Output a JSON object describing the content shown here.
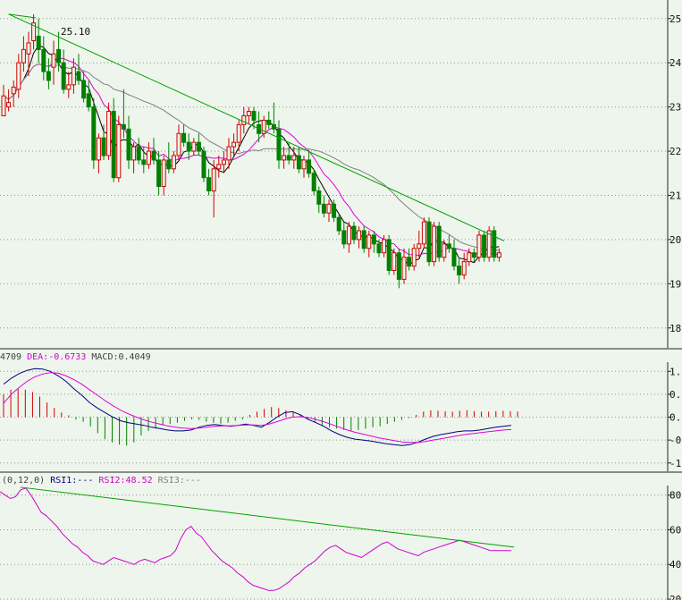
{
  "chart_data": [
    {
      "type": "candlestick",
      "panel": "price",
      "peak_label": "25.10",
      "y_tick_labels": [
        "25.",
        "24.",
        "23.",
        "22.",
        "21.",
        "20.",
        "19.",
        "18."
      ],
      "y_ticks": [
        25,
        24,
        23,
        22,
        21,
        20,
        19,
        18
      ],
      "ylim": [
        17.55,
        25.42
      ],
      "grid": true,
      "up_color": "#d00000",
      "down_color": "#008000",
      "ma_colors": [
        "#000000",
        "#e000e0",
        "#808080"
      ],
      "trendline_color": "#00a000",
      "trendline": [
        [
          1,
          25.1
        ],
        [
          100,
          19.97
        ]
      ],
      "candles": [
        [
          22.8,
          23.5,
          23.0,
          23.25
        ],
        [
          23.0,
          23.4,
          22.9,
          23.1
        ],
        [
          23.3,
          23.6,
          23.0,
          23.45
        ],
        [
          23.4,
          24.2,
          23.2,
          24.0
        ],
        [
          24.0,
          24.6,
          23.8,
          24.3
        ],
        [
          24.2,
          24.7,
          23.7,
          24.45
        ],
        [
          24.5,
          25.1,
          24.3,
          24.9
        ],
        [
          24.6,
          25.0,
          24.0,
          24.3
        ],
        [
          24.3,
          24.6,
          23.6,
          23.8
        ],
        [
          23.8,
          24.1,
          23.4,
          23.6
        ],
        [
          23.9,
          24.5,
          23.5,
          24.2
        ],
        [
          24.3,
          24.7,
          23.8,
          24.0
        ],
        [
          24.0,
          24.3,
          23.3,
          23.4
        ],
        [
          23.4,
          23.8,
          23.2,
          23.5
        ],
        [
          23.5,
          24.1,
          23.3,
          23.9
        ],
        [
          23.8,
          24.2,
          23.5,
          23.6
        ],
        [
          23.6,
          23.8,
          23.1,
          23.2
        ],
        [
          23.3,
          23.6,
          22.9,
          23.0
        ],
        [
          23.0,
          23.2,
          21.6,
          21.8
        ],
        [
          21.8,
          22.4,
          21.5,
          22.3
        ],
        [
          22.3,
          22.6,
          21.8,
          21.9
        ],
        [
          21.9,
          23.1,
          21.8,
          22.9
        ],
        [
          22.9,
          23.2,
          21.3,
          21.4
        ],
        [
          21.4,
          22.8,
          21.3,
          22.6
        ],
        [
          22.6,
          23.4,
          22.3,
          22.5
        ],
        [
          22.5,
          22.8,
          21.6,
          21.8
        ],
        [
          21.8,
          22.2,
          21.5,
          22.1
        ],
        [
          22.1,
          22.3,
          21.7,
          21.8
        ],
        [
          21.8,
          22.1,
          21.5,
          21.7
        ],
        [
          21.7,
          22.2,
          21.6,
          22.0
        ],
        [
          22.0,
          22.3,
          21.7,
          21.8
        ],
        [
          21.8,
          22.0,
          21.0,
          21.2
        ],
        [
          21.2,
          21.9,
          21.0,
          21.8
        ],
        [
          21.8,
          22.2,
          21.5,
          21.6
        ],
        [
          21.6,
          22.0,
          21.5,
          21.9
        ],
        [
          21.9,
          22.6,
          21.8,
          22.4
        ],
        [
          22.4,
          22.6,
          22.1,
          22.2
        ],
        [
          22.2,
          22.4,
          21.8,
          22.0
        ],
        [
          22.0,
          22.3,
          21.9,
          22.2
        ],
        [
          22.2,
          22.4,
          21.9,
          22.0
        ],
        [
          22.0,
          22.1,
          21.3,
          21.4
        ],
        [
          21.4,
          21.6,
          21.0,
          21.1
        ],
        [
          21.1,
          21.8,
          20.5,
          21.6
        ],
        [
          21.6,
          21.9,
          21.4,
          21.7
        ],
        [
          21.7,
          22.0,
          21.5,
          21.8
        ],
        [
          21.8,
          22.3,
          21.6,
          22.1
        ],
        [
          22.1,
          22.4,
          21.9,
          22.2
        ],
        [
          22.2,
          22.7,
          22.0,
          22.6
        ],
        [
          22.6,
          23.0,
          22.4,
          22.8
        ],
        [
          22.8,
          23.0,
          22.6,
          22.9
        ],
        [
          22.9,
          23.0,
          22.5,
          22.7
        ],
        [
          22.6,
          22.9,
          22.2,
          22.4
        ],
        [
          22.4,
          22.8,
          22.3,
          22.7
        ],
        [
          22.7,
          22.9,
          22.5,
          22.6
        ],
        [
          22.6,
          23.1,
          22.4,
          22.5
        ],
        [
          22.5,
          22.7,
          21.6,
          21.8
        ],
        [
          21.8,
          22.1,
          21.6,
          21.9
        ],
        [
          21.9,
          22.2,
          21.7,
          21.8
        ],
        [
          21.8,
          22.1,
          21.6,
          21.9
        ],
        [
          21.9,
          22.1,
          21.5,
          21.6
        ],
        [
          21.6,
          21.9,
          21.4,
          21.8
        ],
        [
          21.8,
          22.0,
          21.4,
          21.5
        ],
        [
          21.5,
          21.6,
          21.0,
          21.1
        ],
        [
          21.1,
          21.2,
          20.6,
          20.8
        ],
        [
          20.8,
          21.0,
          20.5,
          20.6
        ],
        [
          20.6,
          20.9,
          20.4,
          20.8
        ],
        [
          20.8,
          20.9,
          20.4,
          20.5
        ],
        [
          20.5,
          20.6,
          20.1,
          20.2
        ],
        [
          20.2,
          20.4,
          19.8,
          19.9
        ],
        [
          19.9,
          20.4,
          19.7,
          20.3
        ],
        [
          20.3,
          20.4,
          19.9,
          20.0
        ],
        [
          20.0,
          20.3,
          19.8,
          20.2
        ],
        [
          20.2,
          20.3,
          19.7,
          19.8
        ],
        [
          19.8,
          20.2,
          19.6,
          20.1
        ],
        [
          20.1,
          20.2,
          19.7,
          19.9
        ],
        [
          19.9,
          20.0,
          19.6,
          19.7
        ],
        [
          19.7,
          20.1,
          19.6,
          20.0
        ],
        [
          20.0,
          20.1,
          19.2,
          19.3
        ],
        [
          19.3,
          19.8,
          19.2,
          19.7
        ],
        [
          19.7,
          19.8,
          18.9,
          19.1
        ],
        [
          19.1,
          19.8,
          19.0,
          19.6
        ],
        [
          19.6,
          19.8,
          19.3,
          19.4
        ],
        [
          19.4,
          19.9,
          19.3,
          19.8
        ],
        [
          19.8,
          20.2,
          19.6,
          19.9
        ],
        [
          19.9,
          20.5,
          19.8,
          20.4
        ],
        [
          20.4,
          20.5,
          19.4,
          19.5
        ],
        [
          19.5,
          20.4,
          19.4,
          20.3
        ],
        [
          20.3,
          20.4,
          19.5,
          19.6
        ],
        [
          19.6,
          20.0,
          19.5,
          19.9
        ],
        [
          19.9,
          20.1,
          19.7,
          19.8
        ],
        [
          19.8,
          20.0,
          19.3,
          19.4
        ],
        [
          19.4,
          19.6,
          19.0,
          19.2
        ],
        [
          19.2,
          19.7,
          19.1,
          19.5
        ],
        [
          19.5,
          19.8,
          19.4,
          19.7
        ],
        [
          19.7,
          19.8,
          19.5,
          19.6
        ],
        [
          19.6,
          20.2,
          19.5,
          20.1
        ],
        [
          20.1,
          20.2,
          19.5,
          19.6
        ],
        [
          19.6,
          20.3,
          19.5,
          20.2
        ],
        [
          20.2,
          20.3,
          19.5,
          19.6
        ],
        [
          19.6,
          19.8,
          19.5,
          19.7
        ]
      ]
    },
    {
      "type": "line",
      "panel": "macd",
      "legend_fragment": "4709",
      "legend": [
        {
          "text": "DEA:-0.6733",
          "color": "#d000d0"
        },
        {
          "text": " MACD:0.4049",
          "color": "#404040"
        }
      ],
      "y_tick_labels": [
        "1.0",
        "0.5",
        "0.0",
        "-0.",
        "-1."
      ],
      "y_ticks": [
        1.0,
        0.5,
        0.0,
        -0.5,
        -1.0
      ],
      "ylim": [
        -1.18,
        1.2
      ],
      "grid": true,
      "series": [
        {
          "color": "#000080",
          "values": [
            0.72,
            0.85,
            0.95,
            1.02,
            1.06,
            1.05,
            1.0,
            0.9,
            0.78,
            0.62,
            0.48,
            0.32,
            0.2,
            0.1,
            0.0,
            -0.08,
            -0.12,
            -0.15,
            -0.18,
            -0.22,
            -0.25,
            -0.28,
            -0.3,
            -0.3,
            -0.28,
            -0.22,
            -0.18,
            -0.16,
            -0.18,
            -0.2,
            -0.18,
            -0.15,
            -0.18,
            -0.22,
            -0.12,
            0.0,
            0.1,
            0.12,
            0.05,
            -0.05,
            -0.12,
            -0.2,
            -0.3,
            -0.38,
            -0.44,
            -0.48,
            -0.5,
            -0.52,
            -0.55,
            -0.58,
            -0.6,
            -0.62,
            -0.6,
            -0.55,
            -0.48,
            -0.42,
            -0.38,
            -0.35,
            -0.32,
            -0.3,
            -0.3,
            -0.28,
            -0.25,
            -0.22,
            -0.2,
            -0.18
          ]
        },
        {
          "color": "#e000e0",
          "values": [
            0.3,
            0.5,
            0.65,
            0.78,
            0.88,
            0.94,
            0.97,
            0.96,
            0.9,
            0.82,
            0.72,
            0.6,
            0.48,
            0.36,
            0.25,
            0.15,
            0.07,
            0.0,
            -0.06,
            -0.11,
            -0.15,
            -0.19,
            -0.22,
            -0.24,
            -0.25,
            -0.24,
            -0.22,
            -0.2,
            -0.19,
            -0.19,
            -0.18,
            -0.17,
            -0.17,
            -0.18,
            -0.15,
            -0.1,
            -0.04,
            0.0,
            0.01,
            -0.01,
            -0.05,
            -0.1,
            -0.16,
            -0.22,
            -0.28,
            -0.33,
            -0.37,
            -0.41,
            -0.45,
            -0.48,
            -0.51,
            -0.54,
            -0.55,
            -0.55,
            -0.53,
            -0.5,
            -0.47,
            -0.44,
            -0.41,
            -0.38,
            -0.36,
            -0.34,
            -0.32,
            -0.3,
            -0.28,
            -0.27
          ]
        }
      ],
      "bars": [
        0.5,
        0.6,
        0.62,
        0.6,
        0.55,
        0.45,
        0.32,
        0.2,
        0.1,
        0.04,
        -0.05,
        -0.1,
        -0.2,
        -0.35,
        -0.48,
        -0.55,
        -0.6,
        -0.62,
        -0.55,
        -0.4,
        -0.3,
        -0.25,
        -0.18,
        -0.15,
        -0.12,
        -0.08,
        -0.05,
        -0.06,
        -0.1,
        -0.12,
        -0.14,
        -0.12,
        -0.08,
        -0.05,
        0.05,
        0.12,
        0.18,
        0.22,
        0.2,
        0.15,
        0.1,
        0.05,
        -0.05,
        -0.12,
        -0.18,
        -0.22,
        -0.25,
        -0.28,
        -0.3,
        -0.28,
        -0.25,
        -0.22,
        -0.2,
        -0.15,
        -0.1,
        -0.06,
        -0.02,
        0.05,
        0.12,
        0.15,
        0.14,
        0.13,
        0.12,
        0.14,
        0.15,
        0.13,
        0.12,
        0.12,
        0.13,
        0.14,
        0.13,
        0.12
      ]
    },
    {
      "type": "line",
      "panel": "rsi",
      "legend": [
        {
          "text": "(0,12,0)",
          "color": "#404040"
        },
        {
          "text": " RSI1:---",
          "color": "#000080"
        },
        {
          "text": " RSI2:48.52",
          "color": "#d000d0"
        },
        {
          "text": " RSI3:---",
          "color": "#808080"
        }
      ],
      "y_tick_labels": [
        "80",
        "60",
        "40",
        "20"
      ],
      "y_ticks": [
        80,
        60,
        40,
        20
      ],
      "ylim": [
        19.5,
        85.5
      ],
      "grid": true,
      "trendline_color": "#00a000",
      "trendline": [
        [
          0.18,
          84.5
        ],
        [
          0.77,
          50.0
        ]
      ],
      "series": [
        {
          "name": "RSI2",
          "color": "#d000d0",
          "values": [
            82,
            80,
            78,
            79,
            83,
            84,
            80,
            75,
            70,
            68,
            65,
            62,
            58,
            55,
            52,
            50,
            47,
            45,
            42,
            41,
            40,
            42,
            44,
            43,
            42,
            41,
            40,
            42,
            43,
            42,
            41,
            43,
            44,
            45,
            48,
            55,
            60,
            62,
            58,
            56,
            52,
            48,
            45,
            42,
            40,
            38,
            35,
            33,
            30,
            28,
            27,
            26,
            25,
            25,
            26,
            28,
            30,
            33,
            35,
            38,
            40,
            42,
            45,
            48,
            50,
            51,
            49,
            47,
            46,
            45,
            44,
            46,
            48,
            50,
            52,
            53,
            51,
            49,
            48,
            47,
            46,
            45,
            47,
            48,
            49,
            50,
            51,
            52,
            53,
            54,
            53,
            52,
            51,
            50,
            49,
            48,
            48,
            48,
            48,
            48
          ]
        }
      ]
    }
  ]
}
